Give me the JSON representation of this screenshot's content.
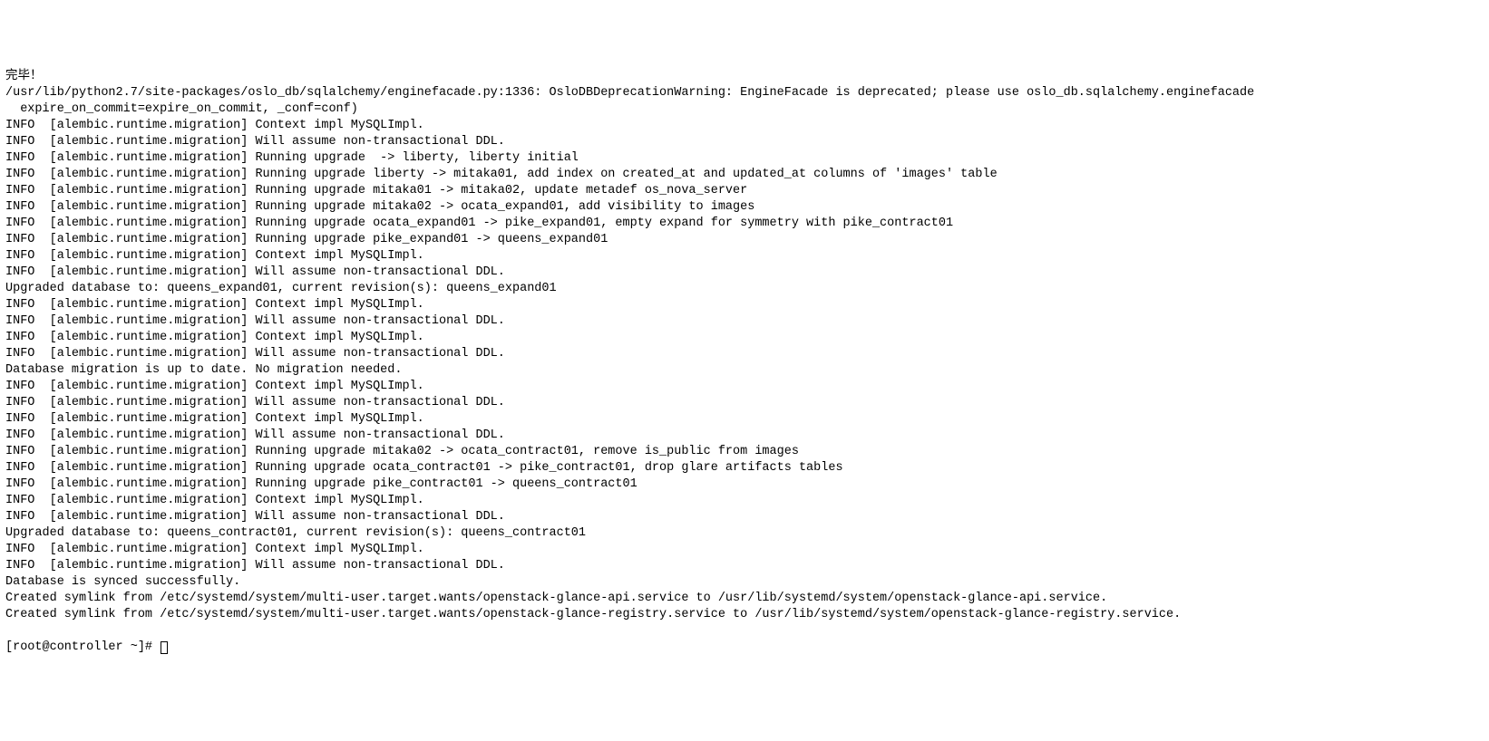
{
  "lines": [
    "完毕！",
    "/usr/lib/python2.7/site-packages/oslo_db/sqlalchemy/enginefacade.py:1336: OsloDBDeprecationWarning: EngineFacade is deprecated; please use oslo_db.sqlalchemy.enginefacade",
    "  expire_on_commit=expire_on_commit, _conf=conf)",
    "INFO  [alembic.runtime.migration] Context impl MySQLImpl.",
    "INFO  [alembic.runtime.migration] Will assume non-transactional DDL.",
    "INFO  [alembic.runtime.migration] Running upgrade  -> liberty, liberty initial",
    "INFO  [alembic.runtime.migration] Running upgrade liberty -> mitaka01, add index on created_at and updated_at columns of 'images' table",
    "INFO  [alembic.runtime.migration] Running upgrade mitaka01 -> mitaka02, update metadef os_nova_server",
    "INFO  [alembic.runtime.migration] Running upgrade mitaka02 -> ocata_expand01, add visibility to images",
    "INFO  [alembic.runtime.migration] Running upgrade ocata_expand01 -> pike_expand01, empty expand for symmetry with pike_contract01",
    "INFO  [alembic.runtime.migration] Running upgrade pike_expand01 -> queens_expand01",
    "INFO  [alembic.runtime.migration] Context impl MySQLImpl.",
    "INFO  [alembic.runtime.migration] Will assume non-transactional DDL.",
    "Upgraded database to: queens_expand01, current revision(s): queens_expand01",
    "INFO  [alembic.runtime.migration] Context impl MySQLImpl.",
    "INFO  [alembic.runtime.migration] Will assume non-transactional DDL.",
    "INFO  [alembic.runtime.migration] Context impl MySQLImpl.",
    "INFO  [alembic.runtime.migration] Will assume non-transactional DDL.",
    "Database migration is up to date. No migration needed.",
    "INFO  [alembic.runtime.migration] Context impl MySQLImpl.",
    "INFO  [alembic.runtime.migration] Will assume non-transactional DDL.",
    "INFO  [alembic.runtime.migration] Context impl MySQLImpl.",
    "INFO  [alembic.runtime.migration] Will assume non-transactional DDL.",
    "INFO  [alembic.runtime.migration] Running upgrade mitaka02 -> ocata_contract01, remove is_public from images",
    "INFO  [alembic.runtime.migration] Running upgrade ocata_contract01 -> pike_contract01, drop glare artifacts tables",
    "INFO  [alembic.runtime.migration] Running upgrade pike_contract01 -> queens_contract01",
    "INFO  [alembic.runtime.migration] Context impl MySQLImpl.",
    "INFO  [alembic.runtime.migration] Will assume non-transactional DDL.",
    "Upgraded database to: queens_contract01, current revision(s): queens_contract01",
    "INFO  [alembic.runtime.migration] Context impl MySQLImpl.",
    "INFO  [alembic.runtime.migration] Will assume non-transactional DDL.",
    "Database is synced successfully.",
    "Created symlink from /etc/systemd/system/multi-user.target.wants/openstack-glance-api.service to /usr/lib/systemd/system/openstack-glance-api.service.",
    "Created symlink from /etc/systemd/system/multi-user.target.wants/openstack-glance-registry.service to /usr/lib/systemd/system/openstack-glance-registry.service."
  ],
  "prompt": "[root@controller ~]# "
}
